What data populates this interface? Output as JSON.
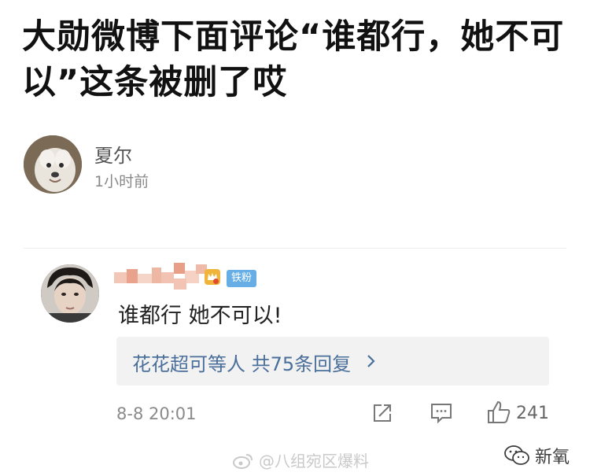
{
  "post": {
    "title": "大勋微博下面评论“谁都行，她不可以”这条被删了哎",
    "author": {
      "name": "夏尔",
      "time": "1小时前"
    }
  },
  "comment": {
    "badge": "铁粉",
    "text": "谁都行 她不可以!",
    "replies_label": "花花超可等人 共75条回复",
    "time": "8-8 20:01",
    "like_count": "241"
  },
  "watermarks": {
    "weibo": "@八组宛区爆料",
    "wechat": "新氧"
  },
  "colors": {
    "link": "#4a6f9a",
    "badge": "#66aee5",
    "crown": "#f0b43a"
  }
}
